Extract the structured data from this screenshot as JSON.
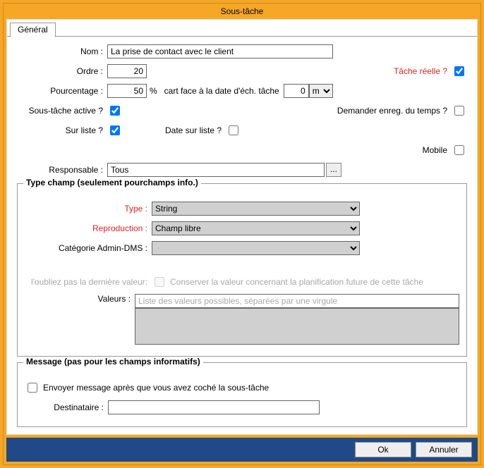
{
  "window": {
    "title": "Sous-tâche"
  },
  "tabs": {
    "general": "Général"
  },
  "form": {
    "nom_label": "Nom :",
    "nom_value": "La prise de contact avec le client",
    "ordre_label": "Ordre :",
    "ordre_value": "20",
    "tache_reelle_label": "Tâche réelle ?",
    "pourcentage_label": "Pourcentage :",
    "pourcentage_value": "50",
    "pourcentage_unit": "%",
    "cart_label": "cart face à la date d'éch. tâche",
    "cart_value": "0",
    "cart_unit": "m",
    "soustache_active_label": "Sous-tâche active ?",
    "demander_enreg_label": "Demander enreg. du temps ?",
    "sur_liste_label": "Sur liste ?",
    "date_sur_liste_label": "Date sur liste ?",
    "mobile_label": "Mobile",
    "responsable_label": "Responsable :",
    "responsable_value": "Tous",
    "ellipsis": "..."
  },
  "typechamp": {
    "legend": "Type champ (seulement pourchamps info.)",
    "type_label": "Type :",
    "type_value": "String",
    "reproduction_label": "Reproduction :",
    "reproduction_value": "Champ libre",
    "categorie_label": "Catégorie Admin-DMS :",
    "categorie_value": "",
    "oubliez_label": "l'oubliez pas la dernière valeur:",
    "oubliez_hint": "Conserver la valeur concernant la planification future de cette tâche",
    "valeurs_label": "Valeurs :",
    "valeurs_hint": "Liste des valeurs possibles, séparées par une virgule"
  },
  "message": {
    "legend": "Message (pas pour les champs informatifs)",
    "envoyer_label": "Envoyer message après que vous avez coché la sous-tâche",
    "destinataire_label": "Destinataire :"
  },
  "buttons": {
    "ok": "Ok",
    "cancel": "Annuler"
  }
}
